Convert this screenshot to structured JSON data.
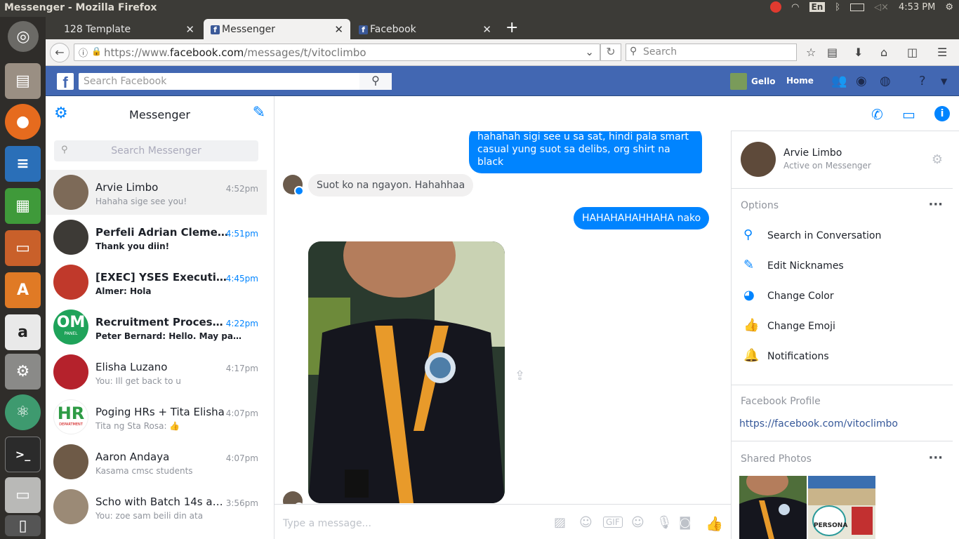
{
  "os": {
    "window_title": "Mozilla Firefox",
    "window_prefix": "Messenger - ",
    "keyboard": "En",
    "clock": "4:53 PM"
  },
  "tabs": [
    {
      "label": "128 Template",
      "active": false
    },
    {
      "label": "Messenger",
      "active": true
    },
    {
      "label": "Facebook",
      "active": false
    }
  ],
  "navbar": {
    "url_prefix": "https://www.",
    "url_domain": "facebook.com",
    "url_path": "/messages/t/vitoclimbo",
    "search_placeholder": "Search"
  },
  "fb": {
    "search_placeholder": "Search Facebook",
    "user_name": "Gello",
    "home_label": "Home"
  },
  "messenger": {
    "title": "Messenger",
    "search_placeholder": "Search Messenger",
    "conversations": [
      {
        "name": "Arvie Limbo",
        "preview": "Hahaha sige see you!",
        "time": "4:52pm"
      },
      {
        "name": "Perfeli Adrian Clemente",
        "preview": "Thank you diin!",
        "time": "4:51pm"
      },
      {
        "name": "[EXEC] YSES Executive Committee",
        "preview": "Almer: Hola",
        "time": "4:45pm"
      },
      {
        "name": "Recruitment Process OM Panel",
        "preview": "Peter Bernard: Hello. May panel interview",
        "time": "4:22pm"
      },
      {
        "name": "Elisha Luzano",
        "preview": "You: Ill get back to u",
        "time": "4:17pm"
      },
      {
        "name": "Poging HRs + Tita Elisha",
        "preview": "Tita ng Sta Rosa:",
        "time": "4:07pm"
      },
      {
        "name": "Aaron Andaya",
        "preview": "Kasama cmsc students",
        "time": "4:07pm"
      },
      {
        "name": "Scho with Batch 14s and Batch 15s",
        "preview": "You: zoe sam beili din ata",
        "time": "3:56pm"
      }
    ],
    "avatar_om": "OM",
    "avatar_om_sub": "PANEL",
    "avatar_hr": "HR",
    "avatar_hr_sub": "DEPARTMENT"
  },
  "chat": {
    "name": "Arvie Limbo",
    "status": "Active on Messenger",
    "messages": [
      {
        "from": "me",
        "text": "hahahah sigi see u sa sat, hindi pala smart casual yung suot sa delibs, org shirt na black"
      },
      {
        "from": "them",
        "text": "Suot ko na ngayon. Hahahhaa"
      },
      {
        "from": "me",
        "text": "HAHAHAHAHHAHA nako"
      }
    ],
    "composer_placeholder": "Type a message..."
  },
  "panel": {
    "name": "Arvie Limbo",
    "status": "Active on Messenger",
    "options_title": "Options",
    "options": [
      {
        "label": "Search in Conversation",
        "icon": "search-icon"
      },
      {
        "label": "Edit Nicknames",
        "icon": "pencil-icon"
      },
      {
        "label": "Change Color",
        "icon": "palette-icon"
      },
      {
        "label": "Change Emoji",
        "icon": "thumbs-up-icon"
      },
      {
        "label": "Notifications",
        "icon": "bell-icon"
      }
    ],
    "profile_title": "Facebook Profile",
    "profile_link": "https://facebook.com/vitoclimbo",
    "photos_title": "Shared Photos",
    "photo_caption": "PERSONA"
  }
}
